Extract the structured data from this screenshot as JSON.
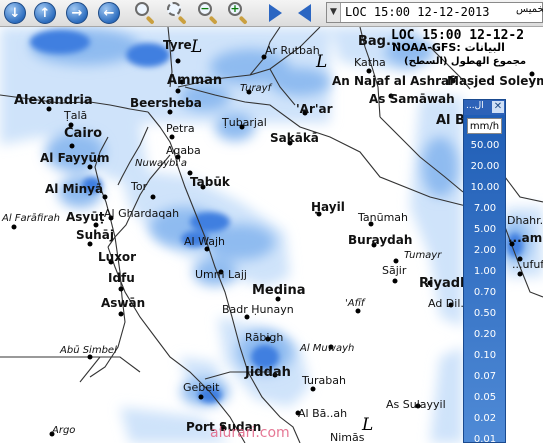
{
  "toolbar": {
    "date_text": "LOC 15:00 12-12-2013",
    "date_arabic": "الخميس",
    "icons": [
      "arrow-down-icon",
      "arrow-up-icon",
      "arrow-right-icon",
      "arrow-left-icon",
      "zoom-icon",
      "zoom-fit-icon",
      "zoom-out-icon",
      "zoom-in-icon",
      "play-forward-icon",
      "play-back-icon"
    ]
  },
  "header": {
    "loc_time": "LOC 15:00 12-12-2",
    "model": "NOAA-GFS: البيانات",
    "product": "مجموع الهطول (السطح)"
  },
  "legend": {
    "title": "...ال",
    "unit": "mm/h",
    "values": [
      "50.00",
      "20.00",
      "10.00",
      "7.00",
      "5.00",
      "2.00",
      "1.00",
      "0.70",
      "0.50",
      "0.20",
      "0.10",
      "0.07",
      "0.05",
      "0.02",
      "0.01"
    ]
  },
  "map": {
    "pressure_markers": [
      "L",
      "L",
      "L"
    ],
    "cities": [
      {
        "name": "Tyre",
        "style": "b"
      },
      {
        "name": "Amman",
        "style": "b"
      },
      {
        "name": "Alexandria",
        "style": "big"
      },
      {
        "name": "Ṭalā",
        "style": ""
      },
      {
        "name": "Beersheba",
        "style": "b"
      },
      {
        "name": "Cairo",
        "style": "big"
      },
      {
        "name": "Petra",
        "style": ""
      },
      {
        "name": "Al Fayyūm",
        "style": "b"
      },
      {
        "name": "Aqaba",
        "style": ""
      },
      {
        "name": "Nuwaybi'a",
        "style": "i"
      },
      {
        "name": "Al Minyā",
        "style": "b"
      },
      {
        "name": "Tor",
        "style": ""
      },
      {
        "name": "Al Farāfirah",
        "style": "i"
      },
      {
        "name": "Asyūṭ",
        "style": "b"
      },
      {
        "name": "Al Ghardaqah",
        "style": ""
      },
      {
        "name": "Suhāj",
        "style": "b"
      },
      {
        "name": "Luxor",
        "style": "b"
      },
      {
        "name": "Idfu",
        "style": "b"
      },
      {
        "name": "Aswān",
        "style": "b"
      },
      {
        "name": "Abū Simbel",
        "style": "i"
      },
      {
        "name": "Argo",
        "style": "i"
      },
      {
        "name": "Ar Rutbah",
        "style": ""
      },
      {
        "name": "Turayf",
        "style": "i"
      },
      {
        "name": "Ṭubarjal",
        "style": ""
      },
      {
        "name": "'Ar'ar",
        "style": "b"
      },
      {
        "name": "Sakākā",
        "style": "b"
      },
      {
        "name": "Tabūk",
        "style": "b"
      },
      {
        "name": "Al Wajh",
        "style": ""
      },
      {
        "name": "Umm Lajj",
        "style": ""
      },
      {
        "name": "Ḥayil",
        "style": "b"
      },
      {
        "name": "Tanūmah",
        "style": ""
      },
      {
        "name": "Buraydah",
        "style": "b"
      },
      {
        "name": "Tumayr",
        "style": "i"
      },
      {
        "name": "Sājir",
        "style": ""
      },
      {
        "name": "Medina",
        "style": "big"
      },
      {
        "name": "'Afīf",
        "style": "i"
      },
      {
        "name": "Badr Ḥunayn",
        "style": ""
      },
      {
        "name": "Rābigh",
        "style": ""
      },
      {
        "name": "Al Muwayh",
        "style": "i"
      },
      {
        "name": "Jiddah",
        "style": "big"
      },
      {
        "name": "Turabah",
        "style": ""
      },
      {
        "name": "Gebeit",
        "style": ""
      },
      {
        "name": "Al Bā..ah",
        "style": ""
      },
      {
        "name": "As Sulayyil",
        "style": ""
      },
      {
        "name": "Port Sudan",
        "style": "b"
      },
      {
        "name": "Nimās",
        "style": ""
      },
      {
        "name": "Bag...",
        "style": "big"
      },
      {
        "name": "Katha",
        "style": ""
      },
      {
        "name": "An Najaf al Ashraf",
        "style": "b"
      },
      {
        "name": "Masjed Soleym...",
        "style": "b"
      },
      {
        "name": "As Samāwah",
        "style": "b"
      },
      {
        "name": "Al B...",
        "style": "big"
      },
      {
        "name": "Riyadh",
        "style": "big"
      },
      {
        "name": "Ad Dil...",
        "style": ""
      },
      {
        "name": "Dhahr...",
        "style": ""
      },
      {
        "name": "...amm",
        "style": "b"
      },
      {
        "name": "...ufuf",
        "style": ""
      }
    ]
  },
  "watermark": "alurari.com",
  "colors": {
    "rain_light": "#cfe3fa",
    "rain_mid": "#8fbbf0",
    "rain_dark": "#3f7fe0",
    "legend": "#1e5cb4"
  }
}
